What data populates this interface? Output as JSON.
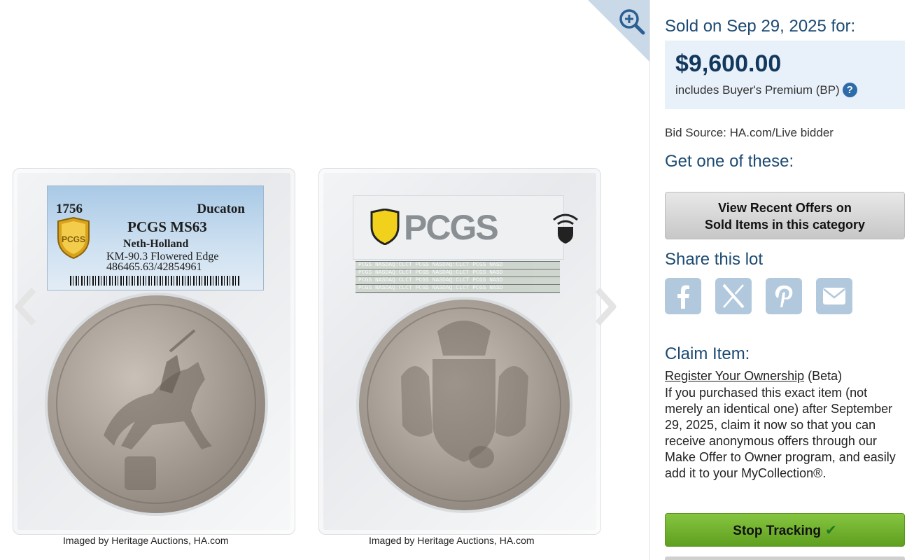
{
  "gallery": {
    "obverse": {
      "label": {
        "year": "1756",
        "denomination": "Ducaton",
        "grade": "PCGS MS63",
        "region": "Neth-Holland",
        "variety": "KM-90.3 Flowered Edge",
        "cert": "486465.63/42854961"
      }
    },
    "reverse": {
      "label_brand": "PCGS",
      "holo_strips": [
        "PCGS NASDAQ:CLCT  PCGS NASDAQ:CLCT  PCGS NASD",
        "PCGS NASDAQ:CLCT  PCGS NASDAQ:CLCT  PCGS NASD",
        "PCGS NASDAQ:CLCT  PCGS NASDAQ:CLCT  PCGS NASD",
        "PCGS NASDAQ:CLCT  PCGS NASDAQ:CLCT  PCGS NASD"
      ]
    },
    "captions": [
      "Imaged by Heritage Auctions, HA.com",
      "Imaged by Heritage Auctions, HA.com"
    ],
    "icons": {
      "zoom": "zoom-in-icon",
      "prev": "chevron-left-icon",
      "next": "chevron-right-icon"
    }
  },
  "panel": {
    "sold_heading": "Sold on Sep 29, 2025 for:",
    "price": "$9,600.00",
    "bp_text": "includes Buyer's Premium (BP)",
    "help_glyph": "?",
    "bid_source": "Bid Source: HA.com/Live bidder",
    "get_one_heading": "Get one of these:",
    "offers_button": {
      "line1": "View Recent Offers on",
      "line2": "Sold Items in this category"
    },
    "share_heading": "Share this lot",
    "share_icons": [
      "facebook-icon",
      "x-icon",
      "pinterest-icon",
      "email-icon"
    ],
    "claim_heading": "Claim Item:",
    "register_link": "Register Your Ownership",
    "register_suffix": " (Beta)",
    "claim_body": "If you purchased this exact item (not merely an identical one) after September 29, 2025, claim it now so that you can receive anonymous offers through our Make Offer to Owner program, and easily add it to your MyCollection®.",
    "track_button": "Stop Tracking",
    "track_check": "✔"
  },
  "colors": {
    "heading_blue": "#1c4a72",
    "price_box_bg": "#e8f1fa",
    "share_icon_bg": "#b2c8dc",
    "track_green": "#6fb02c"
  }
}
